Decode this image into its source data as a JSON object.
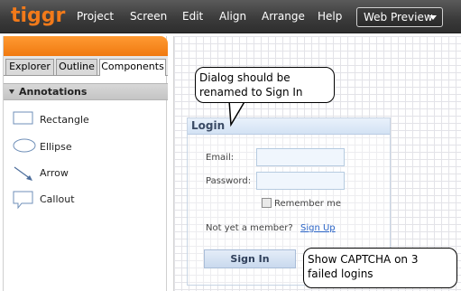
{
  "menubar": {
    "logo_text": "tiggr",
    "items": [
      "Project",
      "Screen",
      "Edit",
      "Align",
      "Arrange",
      "Help"
    ],
    "preview_button": "Web Preview"
  },
  "left_panel": {
    "tabs": [
      "Explorer",
      "Outline",
      "Components"
    ],
    "active_tab": "Components",
    "section_title": "Annotations",
    "tools": [
      "Rectangle",
      "Ellipse",
      "Arrow",
      "Callout"
    ]
  },
  "dialog": {
    "title": "Login",
    "email_label": "Email:",
    "password_label": "Password:",
    "email_value": "",
    "password_value": "",
    "remember_label": "Remember me",
    "remember_checked": false,
    "member_prompt": "Not yet a member?",
    "signup_link": "Sign Up",
    "signin_button": "Sign In"
  },
  "annotations": {
    "callout_top_line1": "Dialog should be",
    "callout_top_line2": "renamed to Sign In",
    "callout_bottom_line1": "Show CAPTCHA on 3",
    "callout_bottom_line2": "failed logins"
  },
  "colors": {
    "brand_orange": "#f27a1a",
    "menubar_dark": "#3a3a3a",
    "link_blue": "#2a64c6"
  }
}
